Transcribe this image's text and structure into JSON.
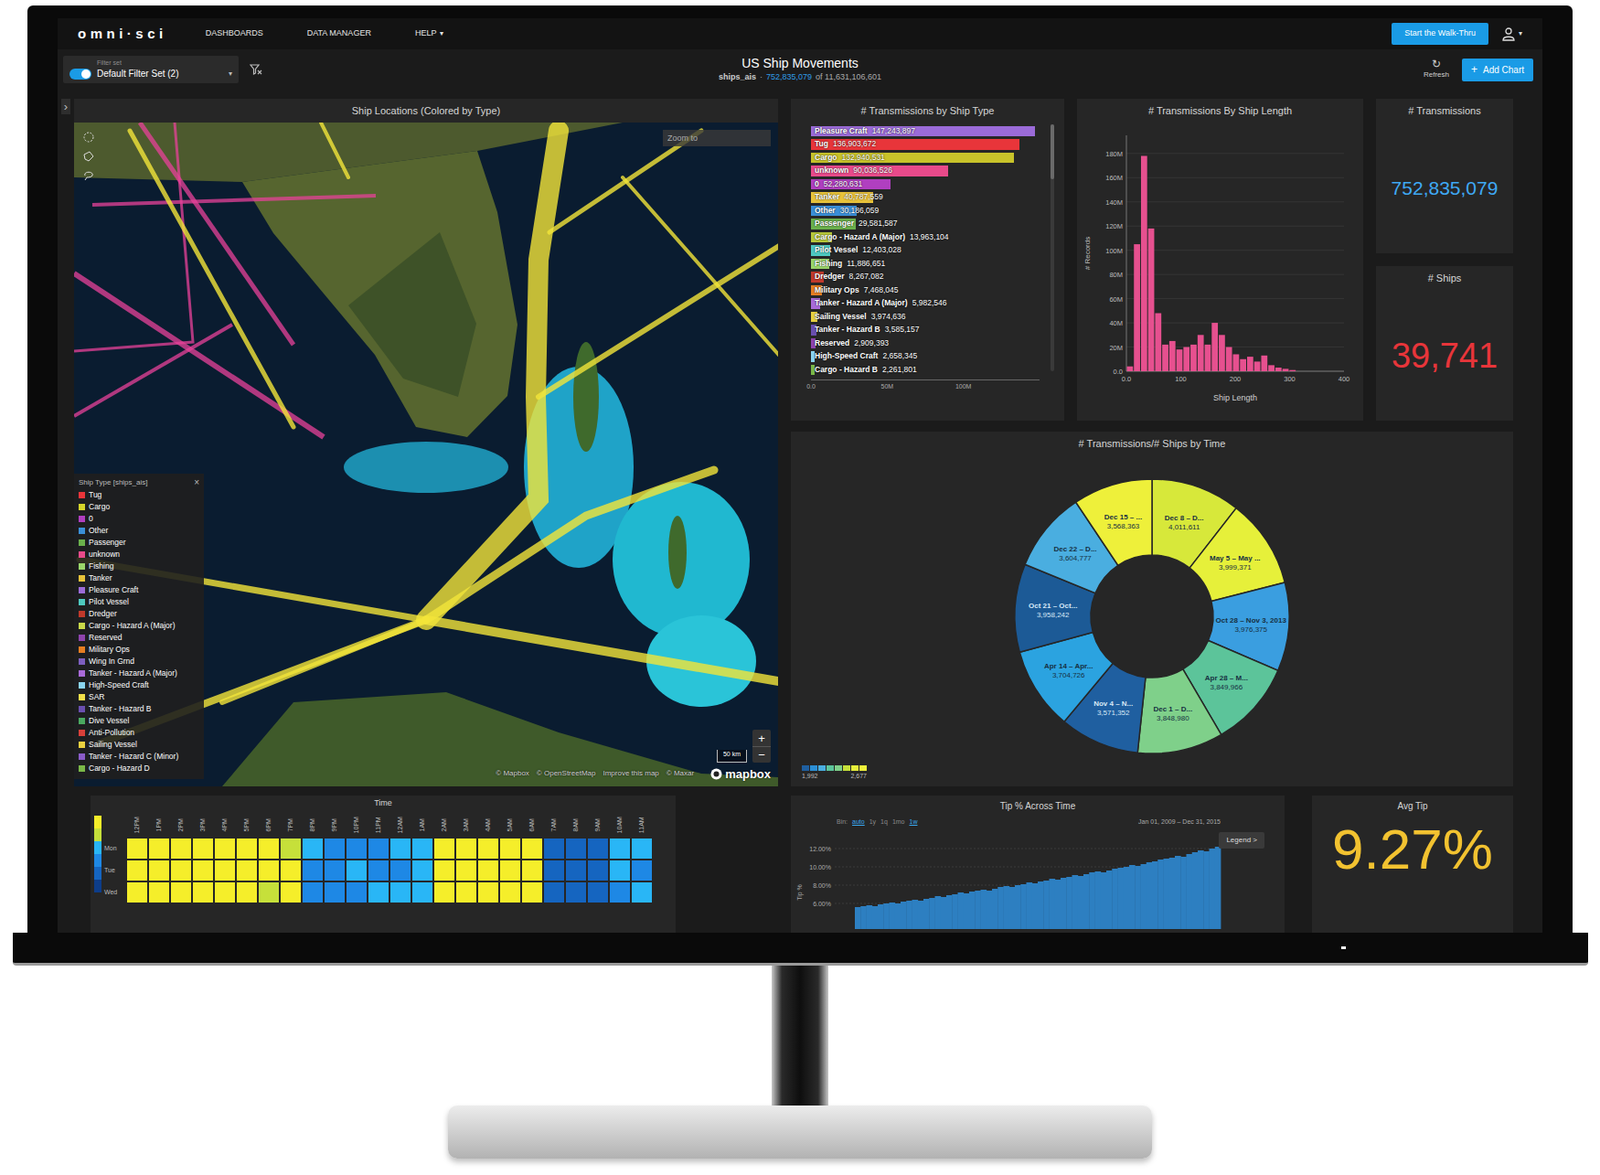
{
  "nav": {
    "logo": "omni·sci",
    "menu": [
      {
        "label": "DASHBOARDS"
      },
      {
        "label": "DATA MANAGER"
      },
      {
        "label": "HELP",
        "caret": "▾"
      }
    ],
    "walkthru": "Start the Walk-Thru",
    "user_caret": "▾"
  },
  "filter": {
    "label": "Filter set",
    "on": true,
    "value": "Default Filter Set (2)",
    "caret": "▾"
  },
  "header": {
    "title": "US Ship Movements",
    "table": "ships_ais",
    "separator": "·",
    "count": "752,835,079",
    "total": "of 11,631,106,601"
  },
  "actions": {
    "refresh_icon": "↻",
    "refresh": "Refresh",
    "add_icon": "+",
    "add": "Add Chart"
  },
  "sidebar_toggle": "›",
  "map": {
    "title": "Ship Locations (Colored by Type)",
    "zoom_placeholder": "Zoom to",
    "legend": {
      "title": "Ship Type [ships_ais]",
      "close": "×",
      "items": [
        {
          "label": "Tug",
          "color": "#e8353a"
        },
        {
          "label": "Cargo",
          "color": "#d4d42a"
        },
        {
          "label": "0",
          "color": "#b03fc0"
        },
        {
          "label": "Other",
          "color": "#3a8fd8"
        },
        {
          "label": "Passenger",
          "color": "#6ab04c"
        },
        {
          "label": "unknown",
          "color": "#e84a8a"
        },
        {
          "label": "Fishing",
          "color": "#9ad66a"
        },
        {
          "label": "Tanker",
          "color": "#e8c33a"
        },
        {
          "label": "Pleasure Craft",
          "color": "#9b6bd8"
        },
        {
          "label": "Pilot Vessel",
          "color": "#4ec9c0"
        },
        {
          "label": "Dredger",
          "color": "#c0392b"
        },
        {
          "label": "Cargo - Hazard A (Major)",
          "color": "#c8d84a"
        },
        {
          "label": "Reserved",
          "color": "#8e44ad"
        },
        {
          "label": "Military Ops",
          "color": "#e67e22"
        },
        {
          "label": "Wing In Grnd",
          "color": "#7d5fc0"
        },
        {
          "label": "Tanker - Hazard A (Major)",
          "color": "#a86ad8"
        },
        {
          "label": "High-Speed Craft",
          "color": "#8ad4f0"
        },
        {
          "label": "SAR",
          "color": "#f0e04a"
        },
        {
          "label": "Tanker - Hazard B",
          "color": "#6a4fb0"
        },
        {
          "label": "Dive Vessel",
          "color": "#4aa860"
        },
        {
          "label": "Anti-Pollution",
          "color": "#d8403a"
        },
        {
          "label": "Sailing Vessel",
          "color": "#e8d040"
        },
        {
          "label": "Tanker - Hazard C (Minor)",
          "color": "#8a5cc8"
        },
        {
          "label": "Cargo - Hazard D",
          "color": "#7ab848"
        }
      ]
    },
    "scale": "50 km",
    "zoom_in": "+",
    "zoom_out": "−",
    "attribution": [
      "© Mapbox",
      "© OpenStreetMap",
      "Improve this map",
      "© Maxar"
    ],
    "brand": "mapbox"
  },
  "bar_chart": {
    "title": "# Transmissions by Ship Type",
    "x_max": 150,
    "x_ticks": [
      {
        "label": "0.0",
        "value": 0
      },
      {
        "label": "50M",
        "value": 50
      },
      {
        "label": "100M",
        "value": 100
      }
    ],
    "bars": [
      {
        "label": "Pleasure Craft",
        "value_text": "147,243,897",
        "value": 147.24,
        "color": "#9b6bd8"
      },
      {
        "label": "Tug",
        "value_text": "136,903,672",
        "value": 136.9,
        "color": "#e8353a"
      },
      {
        "label": "Cargo",
        "value_text": "132,940,531",
        "value": 132.94,
        "color": "#c8c32a"
      },
      {
        "label": "unknown",
        "value_text": "90,036,526",
        "value": 90.04,
        "color": "#e84a8a"
      },
      {
        "label": "0",
        "value_text": "52,280,631",
        "value": 52.28,
        "color": "#b03fc0"
      },
      {
        "label": "Tanker",
        "value_text": "40,787,559",
        "value": 40.79,
        "color": "#e8c33a"
      },
      {
        "label": "Other",
        "value_text": "30,186,059",
        "value": 30.19,
        "color": "#3a8fd8"
      },
      {
        "label": "Passenger",
        "value_text": "29,581,587",
        "value": 29.58,
        "color": "#6ab04c"
      },
      {
        "label": "Cargo - Hazard A (Major)",
        "value_text": "13,963,104",
        "value": 13.96,
        "color": "#b8c83a"
      },
      {
        "label": "Pilot Vessel",
        "value_text": "12,403,028",
        "value": 12.4,
        "color": "#4ec9c0"
      },
      {
        "label": "Fishing",
        "value_text": "11,886,651",
        "value": 11.89,
        "color": "#9ad66a"
      },
      {
        "label": "Dredger",
        "value_text": "8,267,082",
        "value": 8.27,
        "color": "#c0392b"
      },
      {
        "label": "Military Ops",
        "value_text": "7,468,045",
        "value": 7.47,
        "color": "#e67e22"
      },
      {
        "label": "Tanker - Hazard A (Major)",
        "value_text": "5,982,546",
        "value": 5.98,
        "color": "#a86ad8"
      },
      {
        "label": "Sailing Vessel",
        "value_text": "3,974,636",
        "value": 3.97,
        "color": "#e8d040"
      },
      {
        "label": "Tanker - Hazard B",
        "value_text": "3,585,157",
        "value": 3.59,
        "color": "#6a4fb0"
      },
      {
        "label": "Reserved",
        "value_text": "2,909,393",
        "value": 2.91,
        "color": "#8e44ad"
      },
      {
        "label": "High-Speed Craft",
        "value_text": "2,658,345",
        "value": 2.66,
        "color": "#8ad4f0"
      },
      {
        "label": "Cargo - Hazard B",
        "value_text": "2,261,801",
        "value": 2.26,
        "color": "#7ab848"
      }
    ]
  },
  "histogram": {
    "title": "# Transmissions By Ship Length",
    "y_title": "# Records",
    "y_max": 195,
    "y_ticks": [
      {
        "label": "0.0",
        "value": 0
      },
      {
        "label": "20M",
        "value": 20
      },
      {
        "label": "40M",
        "value": 40
      },
      {
        "label": "60M",
        "value": 60
      },
      {
        "label": "80M",
        "value": 80
      },
      {
        "label": "100M",
        "value": 100
      },
      {
        "label": "120M",
        "value": 120
      },
      {
        "label": "140M",
        "value": 140
      },
      {
        "label": "160M",
        "value": 160
      },
      {
        "label": "180M",
        "value": 180
      }
    ],
    "x_max": 400,
    "x_ticks": [
      {
        "label": "0.0",
        "value": 0
      },
      {
        "label": "100",
        "value": 100
      },
      {
        "label": "200",
        "value": 200
      },
      {
        "label": "300",
        "value": 300
      },
      {
        "label": "400",
        "value": 400
      }
    ],
    "x_title": "Ship Length",
    "bin_width": 13,
    "values": [
      4,
      105,
      178,
      118,
      48,
      22,
      25,
      18,
      20,
      22,
      30,
      22,
      40,
      30,
      20,
      14,
      10,
      12,
      8,
      13,
      5,
      3,
      2,
      1
    ]
  },
  "kpis": [
    {
      "title": "# Transmissions",
      "value": "752,835,079",
      "color": "#3fa9f5"
    },
    {
      "title": "# Ships",
      "value": "39,741",
      "color": "#e8353a"
    }
  ],
  "donut": {
    "title": "# Transmissions/# Ships by Time",
    "segments": [
      {
        "label": "Dec 8 – D...",
        "value_text": "4,011,611",
        "value": 4011611,
        "color": "#d7e83a"
      },
      {
        "label": "May 5 – May ...",
        "value_text": "3,999,371",
        "value": 3999371,
        "color": "#e6f03a"
      },
      {
        "label": "Oct 28 – Nov 3, 2013",
        "value_text": "3,976,375",
        "value": 3976375,
        "color": "#3a9ee0"
      },
      {
        "label": "Apr 28 – M...",
        "value_text": "3,849,966",
        "value": 3849966,
        "color": "#5cc49a"
      },
      {
        "label": "Dec 1 – D...",
        "value_text": "3,848,980",
        "value": 3848980,
        "color": "#7fd08a"
      },
      {
        "label": "Nov 4 – N...",
        "value_text": "3,571,352",
        "value": 3571352,
        "color": "#1f5fa0"
      },
      {
        "label": "Apr 14 – Apr...",
        "value_text": "3,704,726",
        "value": 3704726,
        "color": "#2ba3e0"
      },
      {
        "label": "Oct 21 – Oct...",
        "value_text": "3,958,242",
        "value": 3958242,
        "color": "#1c5a96"
      },
      {
        "label": "Dec 22 – D...",
        "value_text": "3,604,777",
        "value": 3604777,
        "color": "#4aaee0"
      },
      {
        "label": "Dec 15 – ...",
        "value_text": "3,568,363",
        "value": 3568363,
        "color": "#eef03a"
      }
    ],
    "legend": {
      "min": "1,992",
      "max": "2,677",
      "colors": [
        "#1f5fa0",
        "#2b8fd6",
        "#4aaee0",
        "#5cc49a",
        "#7fd08a",
        "#c6e03a",
        "#e6f03a",
        "#eef03a"
      ]
    }
  },
  "heatmap": {
    "title": "Time",
    "columns": [
      "12PM",
      "1PM",
      "2PM",
      "3PM",
      "4PM",
      "5PM",
      "6PM",
      "7PM",
      "8PM",
      "9PM",
      "10PM",
      "11PM",
      "12AM",
      "1AM",
      "2AM",
      "3AM",
      "4AM",
      "5AM",
      "6AM",
      "7AM",
      "8AM",
      "9AM",
      "10AM",
      "11AM"
    ],
    "color_scale": [
      "#0d3d8a",
      "#1565c0",
      "#1e88e5",
      "#29b6f6",
      "#c6e03a",
      "#f5ee2a"
    ],
    "rows": [
      {
        "label": "Mon",
        "values": [
          0.95,
          0.92,
          0.95,
          0.9,
          0.93,
          0.95,
          0.9,
          0.88,
          0.5,
          0.45,
          0.48,
          0.42,
          0.5,
          0.55,
          0.92,
          0.95,
          0.93,
          0.9,
          0.94,
          0.12,
          0.15,
          0.2,
          0.55,
          0.5
        ]
      },
      {
        "label": "Tue",
        "values": [
          0.93,
          0.95,
          0.9,
          0.92,
          0.95,
          0.9,
          0.93,
          0.9,
          0.45,
          0.4,
          0.5,
          0.48,
          0.45,
          0.6,
          0.9,
          0.93,
          0.95,
          0.92,
          0.9,
          0.1,
          0.18,
          0.15,
          0.5,
          0.45
        ]
      },
      {
        "label": "Wed",
        "values": [
          0.9,
          0.93,
          0.95,
          0.9,
          0.92,
          0.95,
          0.88,
          0.9,
          0.48,
          0.42,
          0.45,
          0.5,
          0.52,
          0.58,
          0.95,
          0.9,
          0.92,
          0.95,
          0.9,
          0.14,
          0.12,
          0.22,
          0.48,
          0.55
        ]
      }
    ]
  },
  "tip": {
    "title": "Tip % Across Time",
    "bin_label": "Bin:",
    "bins": [
      {
        "label": "auto",
        "selected": true
      },
      {
        "label": "1y",
        "selected": false
      },
      {
        "label": "1q",
        "selected": false
      },
      {
        "label": "1mo",
        "selected": false
      },
      {
        "label": "1w",
        "selected": true
      }
    ],
    "range": "Jan 01, 2009 – Dec 31, 2015",
    "legend_button": "Legend >",
    "y_title": "Tip %",
    "y_min": 3,
    "y_max": 14,
    "y_ticks": [
      {
        "label": "12.00%",
        "value": 12
      },
      {
        "label": "10.00%",
        "value": 10
      },
      {
        "label": "8.00%",
        "value": 8
      },
      {
        "label": "6.00%",
        "value": 6
      }
    ],
    "values": [
      5.6,
      5.7,
      5.8,
      5.7,
      5.9,
      6.0,
      6.1,
      6.0,
      6.2,
      6.3,
      6.4,
      6.3,
      6.5,
      6.6,
      6.8,
      6.7,
      6.9,
      7.0,
      7.2,
      7.1,
      7.3,
      7.4,
      7.5,
      7.4,
      7.6,
      7.8,
      7.9,
      7.8,
      8.0,
      8.1,
      8.3,
      8.2,
      8.4,
      8.5,
      8.7,
      8.6,
      8.8,
      8.9,
      9.1,
      9.0,
      9.2,
      9.4,
      9.5,
      9.4,
      9.6,
      9.8,
      9.9,
      10.0,
      10.2,
      10.1,
      10.3,
      10.5,
      10.6,
      10.8,
      10.9,
      11.0,
      11.2,
      11.1,
      11.4,
      11.6,
      11.8,
      11.7,
      12.0,
      12.2
    ]
  },
  "avg_tip": {
    "title": "Avg Tip",
    "value": "9.27%"
  }
}
